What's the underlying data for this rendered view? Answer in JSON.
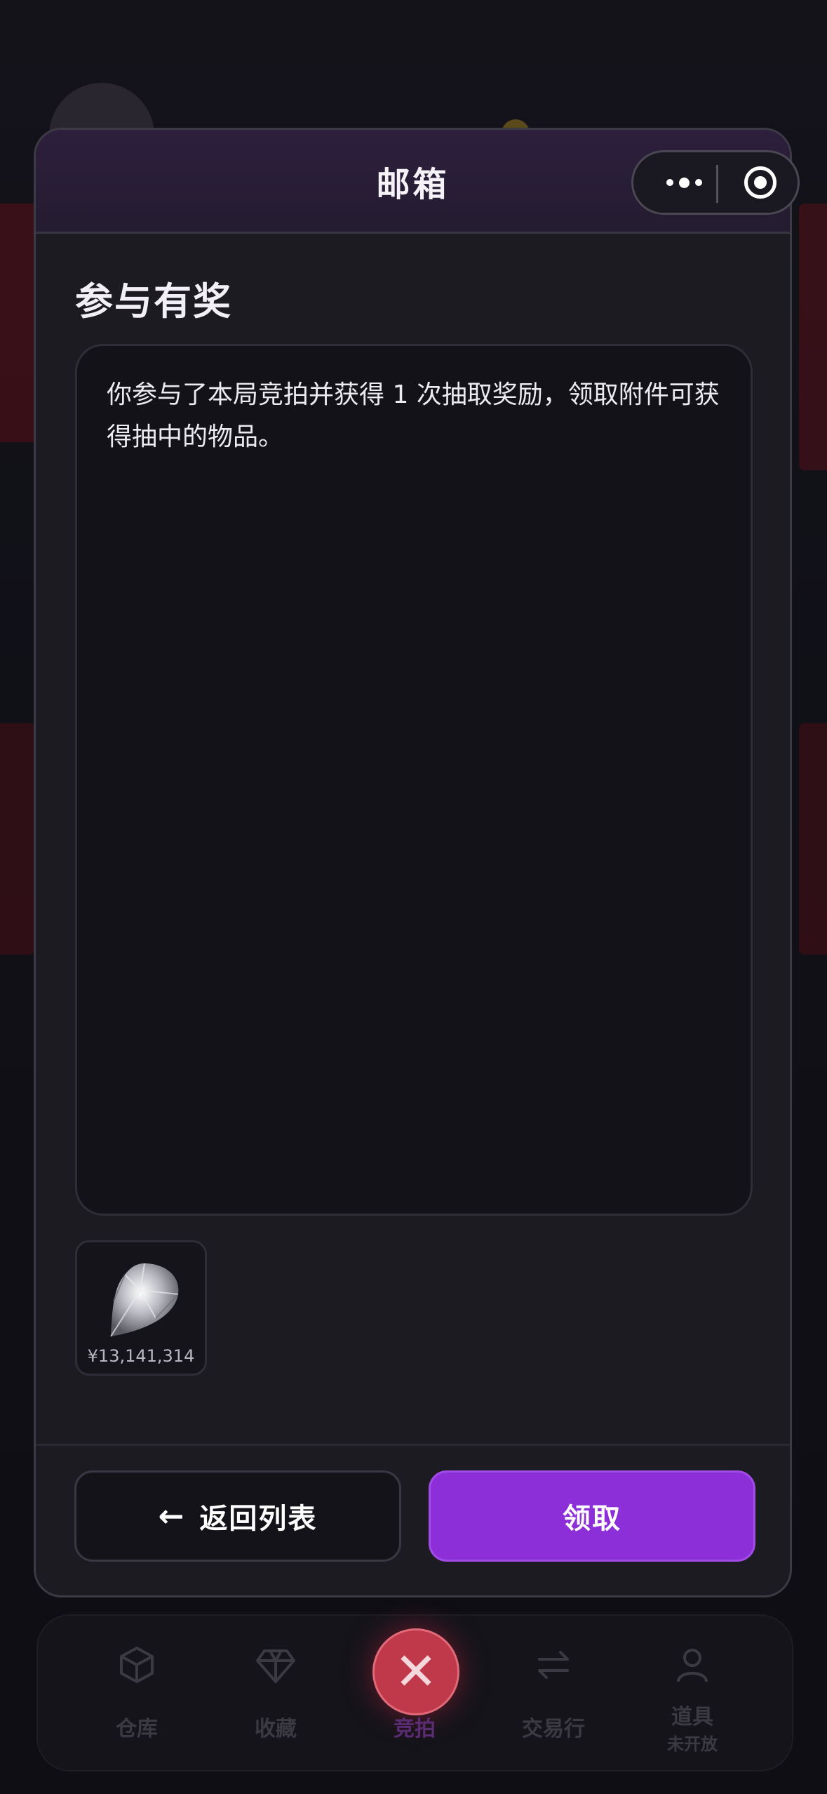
{
  "modal": {
    "title": "邮箱",
    "mail_title": "参与有奖",
    "mail_body": "你参与了本局竞拍并获得 1 次抽取奖励，领取附件可获得抽中的物品。",
    "attachment": {
      "icon": "diamond-gem-icon",
      "price": "¥13,141,314"
    },
    "back_button": {
      "icon": "arrow-left-icon",
      "label": "返回列表"
    },
    "claim_button": {
      "label": "领取"
    },
    "colors": {
      "accent": "#8d2fd8",
      "panel": "#1c1b22",
      "header": "#2d1f3d"
    }
  },
  "tabbar": {
    "tabs": [
      {
        "icon": "box-icon",
        "label": "仓库"
      },
      {
        "icon": "diamond-icon",
        "label": "收藏"
      },
      {
        "icon": "close-icon",
        "label": "竞拍",
        "active": true
      },
      {
        "icon": "swap-icon",
        "label": "交易行"
      },
      {
        "icon": "user-icon",
        "label": "道具",
        "sublabel": "未开放"
      }
    ]
  }
}
